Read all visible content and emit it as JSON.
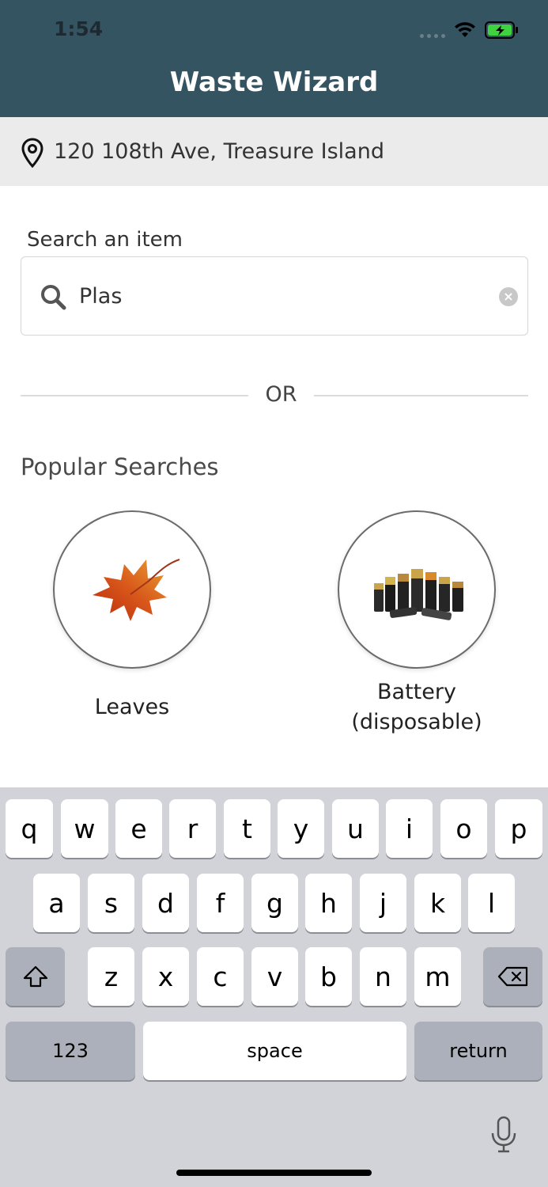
{
  "status_bar": {
    "time": "1:54"
  },
  "header": {
    "title": "Waste Wizard"
  },
  "location": {
    "address": "120 108th Ave, Treasure Island"
  },
  "search": {
    "label": "Search an item",
    "value": "Plas"
  },
  "divider": {
    "text": "OR"
  },
  "popular": {
    "title": "Popular Searches",
    "items": [
      {
        "label": "Leaves",
        "icon": "leaf-icon"
      },
      {
        "label": "Battery (disposable)",
        "icon": "battery-icon"
      }
    ]
  },
  "keyboard": {
    "row1": [
      "q",
      "w",
      "e",
      "r",
      "t",
      "y",
      "u",
      "i",
      "o",
      "p"
    ],
    "row2": [
      "a",
      "s",
      "d",
      "f",
      "g",
      "h",
      "j",
      "k",
      "l"
    ],
    "row3": [
      "z",
      "x",
      "c",
      "v",
      "b",
      "n",
      "m"
    ],
    "numbers_label": "123",
    "space_label": "space",
    "return_label": "return"
  },
  "colors": {
    "header_bg": "#355462",
    "address_bg": "#ebebeb",
    "keyboard_bg": "#d1d3d9",
    "battery_fill": "#3fd13f"
  }
}
